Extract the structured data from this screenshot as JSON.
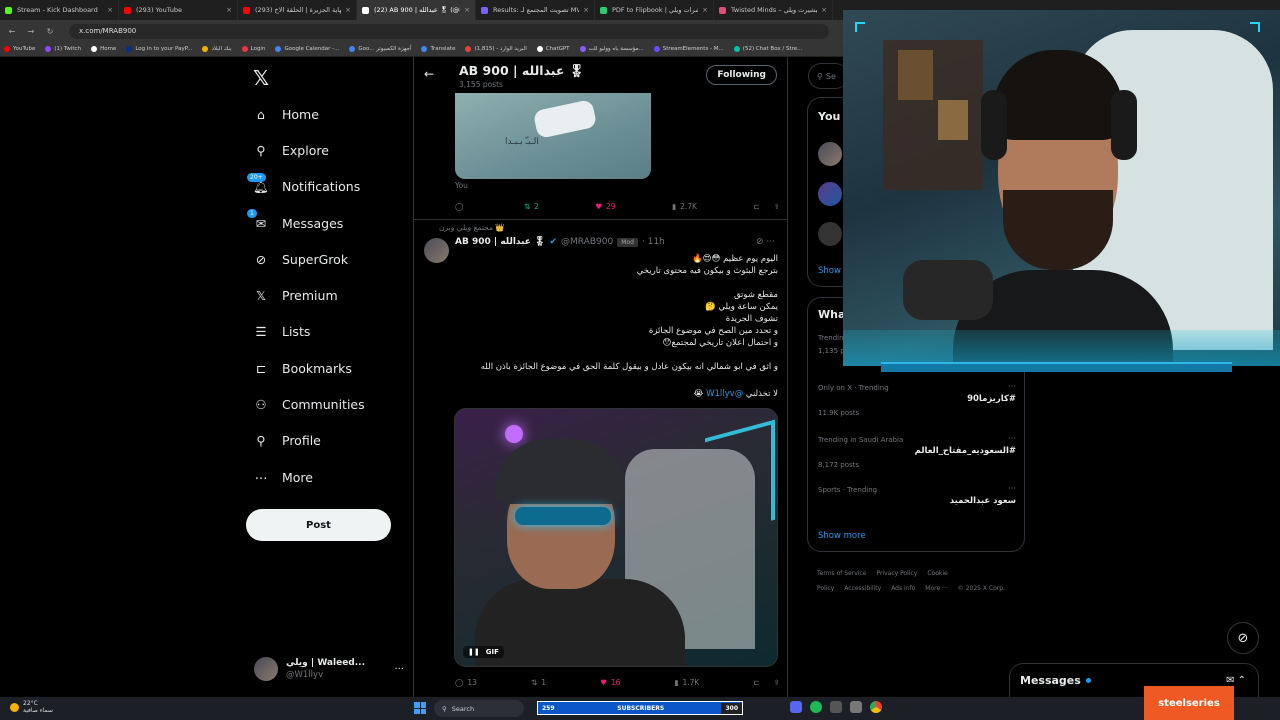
{
  "browser": {
    "tabs": [
      {
        "label": "Stream - Kick Dashboard",
        "color": "#53fc18"
      },
      {
        "label": "(293) YouTube",
        "color": "#ff0000"
      },
      {
        "label": "(293) نهاية الجزيرة | الحلقة الاخ...",
        "color": "#ff0000"
      },
      {
        "label": "(22) AB 900 | عبدالله 🎖 (@MRA...",
        "color": "#ffffff",
        "active": true
      },
      {
        "label": "Results: تصويت المجتمع لـ MVP...",
        "color": "#7b61ff"
      },
      {
        "label": "PDF to Flipbook | نشرات ويلي",
        "color": "#2ecc71"
      },
      {
        "label": "Twisted Minds – تيشيرت ويلي",
        "color": "#e84a7a"
      }
    ],
    "url": "x.com/MRAB900",
    "bookmarks": [
      {
        "label": "YouTube",
        "color": "#ff0000"
      },
      {
        "label": "(1) Twitch",
        "color": "#9146ff"
      },
      {
        "label": "Home",
        "color": "#ffffff"
      },
      {
        "label": "Log in to your PayP...",
        "color": "#003087"
      },
      {
        "label": "بنك البلاد",
        "color": "#f4b400"
      },
      {
        "label": "Login",
        "color": "#e34"
      },
      {
        "label": "Google Calendar -...",
        "color": "#4285f4"
      },
      {
        "label": "Goo... أجهزة الكمبيوتر",
        "color": "#4285f4"
      },
      {
        "label": "Translate",
        "color": "#4285f4"
      },
      {
        "label": "البريد الوارد - (1,815)",
        "color": "#ea4335"
      },
      {
        "label": "ChatGPT",
        "color": "#ffffff"
      },
      {
        "label": "مؤسسة ياه ووليو للت...",
        "color": "#8a5cf6"
      },
      {
        "label": "StreamElements - M...",
        "color": "#6a4cff"
      },
      {
        "label": "(52) Chat Box / Stre...",
        "color": "#00c2a8"
      }
    ]
  },
  "sidebar": {
    "items": [
      {
        "label": "Home",
        "icon": "home-icon"
      },
      {
        "label": "Explore",
        "icon": "search-icon"
      },
      {
        "label": "Notifications",
        "icon": "bell-icon",
        "badge": "20+"
      },
      {
        "label": "Messages",
        "icon": "envelope-icon",
        "badge": "1"
      },
      {
        "label": "SuperGrok",
        "icon": "grok-icon"
      },
      {
        "label": "Premium",
        "icon": "x-logo-icon"
      },
      {
        "label": "Lists",
        "icon": "list-icon"
      },
      {
        "label": "Bookmarks",
        "icon": "bookmark-icon"
      },
      {
        "label": "Communities",
        "icon": "people-icon"
      },
      {
        "label": "Profile",
        "icon": "person-icon"
      },
      {
        "label": "More",
        "icon": "more-circle-icon"
      }
    ],
    "post_label": "Post",
    "account": {
      "name": "ويلي | Waleed...",
      "handle": "@W1llyv"
    }
  },
  "profile_header": {
    "name": "AB 900 | عبدالله 🎖",
    "posts": "3,155 posts",
    "follow_label": "Following"
  },
  "prev_post": {
    "media_text": "الـبـّ    بـبـدا",
    "caption": "You",
    "replies": "",
    "reposts": "2",
    "likes": "29",
    "views": "2.7K"
  },
  "post": {
    "social_context": "مجتمع ويلي وبرن 👑",
    "name": "AB 900 | عبدالله 🎖",
    "handle": "@MRAB900",
    "mod_label": "Mod",
    "time": "· 11h",
    "lines": [
      "اليوم يوم عظيم 😳😍🔥",
      "بترجع البثوث و بيكون فيه محتوى تاريخي",
      "",
      "مقطع شوتق",
      "يمكن ساعة ويلي 🤔",
      "تشوف الجريدة",
      "و تحدد مين الصح في موضوع الجائزة",
      "و احتمال اعلان تاريخي لمجتمع😯",
      "",
      "و اثق في ابو شمالي انه بيكون عادل و بيقول كلمة الحق في موضوع الجائزة باذن الله",
      ""
    ],
    "last_line_text": "لا تخذلني",
    "mention": "@W1llyv",
    "gif_label": "GIF",
    "replies": "13",
    "reposts": "1",
    "likes": "16",
    "views": "1.7K"
  },
  "right": {
    "search_placeholder": "Se",
    "you_box_title": "You",
    "show_label": "Show",
    "whats_title": "Wha",
    "trends": [
      {
        "category": "Trending",
        "title": "",
        "posts": "1,135 posts"
      },
      {
        "category": "Only on X · Trending",
        "title": "#كاريزما90",
        "posts": "11.9K posts"
      },
      {
        "category": "Trending in Saudi Arabia",
        "title": "#السعوديه_مفتاح_العالم",
        "posts": "8,172 posts"
      },
      {
        "category": "Sports · Trending",
        "title": "سعود عبدالحميد",
        "posts": ""
      }
    ],
    "show_more": "Show more",
    "footer": [
      "Terms of Service",
      "Privacy Policy",
      "Cookie Policy",
      "Accessibility",
      "Ads info",
      "More ···",
      "© 2025 X Corp."
    ]
  },
  "messages_drawer": {
    "label": "Messages"
  },
  "overlay": {
    "subs_left": "259",
    "subs_label": "SUBSCRIBERS",
    "subs_right": "300",
    "steelseries": "steelseries"
  },
  "taskbar": {
    "temp": "22°C",
    "weather": "سماء صافية",
    "search": "Search"
  },
  "colors": {
    "accent": "#1d9bf0",
    "like": "#f91880",
    "repost": "#00ba7c"
  }
}
